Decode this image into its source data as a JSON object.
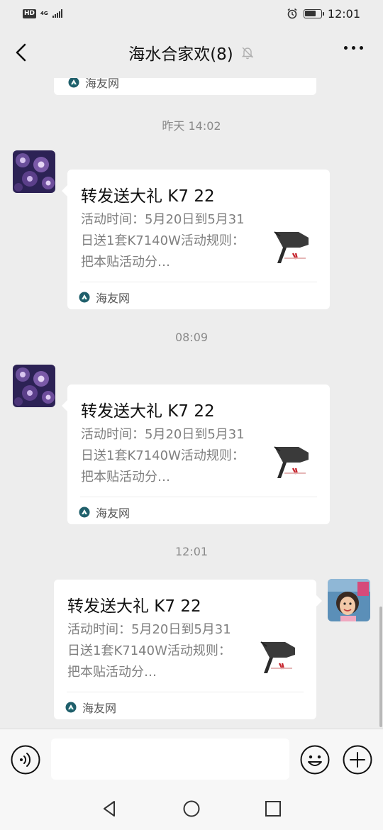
{
  "status_bar": {
    "hd_label": "HD",
    "network": "4G",
    "time": "12:01"
  },
  "header": {
    "title": "海水合家欢(8)"
  },
  "chat": {
    "previous_source": "海友网",
    "messages": [
      {
        "timestamp": "昨天 14:02",
        "side": "left",
        "card": {
          "title": "转发送大礼 K7 22",
          "description": "活动时间：5月20日到5月31日送1套K7140W活动规则：把本贴活动分…",
          "source": "海友网"
        }
      },
      {
        "timestamp": "08:09",
        "side": "left",
        "card": {
          "title": "转发送大礼 K7 22",
          "description": "活动时间：5月20日到5月31日送1套K7140W活动规则：把本贴活动分…",
          "source": "海友网"
        }
      },
      {
        "timestamp": "12:01",
        "side": "right",
        "card": {
          "title": "转发送大礼 K7 22",
          "description": "活动时间：5月20日到5月31日送1套K7140W活动规则：把本贴活动分…",
          "source": "海友网"
        }
      }
    ]
  },
  "input_bar": {
    "message_value": ""
  },
  "colors": {
    "background": "#ededed",
    "card": "#ffffff",
    "timestamp": "#8a8a8a",
    "source_icon": "#1f5f6b"
  },
  "icons": {
    "back": "chevron-left-icon",
    "mute": "bell-off-icon",
    "more": "more-dots-icon",
    "voice": "voice-icon",
    "emoji": "emoji-icon",
    "plus": "plus-icon",
    "nav_back": "triangle-back-icon",
    "nav_home": "circle-home-icon",
    "nav_recent": "square-recent-icon"
  }
}
